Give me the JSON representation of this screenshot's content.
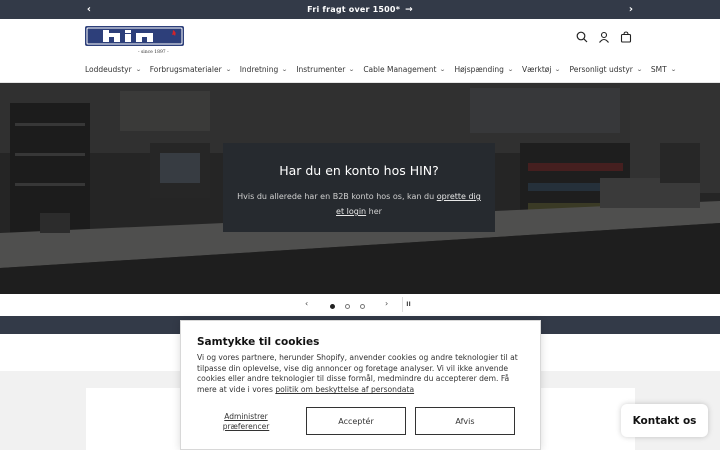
{
  "announcement": {
    "text": "Fri fragt over 1500*",
    "arrow": "→",
    "prev_icon": "chevron-left-icon",
    "next_icon": "chevron-right-icon"
  },
  "header": {
    "logo_text": "hin",
    "logo_tagline": "- since 1897 -",
    "icons": [
      "search-icon",
      "account-icon",
      "cart-icon"
    ]
  },
  "nav": {
    "items": [
      {
        "label": "Loddeudstyr"
      },
      {
        "label": "Forbrugsmaterialer"
      },
      {
        "label": "Indretning"
      },
      {
        "label": "Instrumenter"
      },
      {
        "label": "Cable Management"
      },
      {
        "label": "Højspænding"
      },
      {
        "label": "Værktøj"
      },
      {
        "label": "Personligt udstyr"
      },
      {
        "label": "SMT"
      }
    ]
  },
  "hero": {
    "title": "Har du en konto hos HIN?",
    "text_before": "Hvis du allerede har en B2B konto hos os, kan du ",
    "link1": "oprette dig et login",
    "text_after": " her"
  },
  "slider": {
    "prev": "‹",
    "next": "›",
    "pause": "II",
    "slides": 3,
    "active_slide": 1
  },
  "cookie": {
    "title": "Samtykke til cookies",
    "body": "Vi og vores partnere, herunder Shopify, anvender cookies og andre teknologier til at tilpasse din oplevelse, vise dig annoncer og foretage analyser. Vi vil ikke anvende cookies eller andre teknologier til disse formål, medmindre du accepterer dem. Få mere at vide i vores ",
    "policy_link": "politik om beskyttelse af persondata",
    "preferences": "Administrer præferencer",
    "accept": "Acceptér",
    "reject": "Afvis"
  },
  "chat": {
    "label": "Kontakt os"
  },
  "colors": {
    "dark_bar": "#333a48",
    "logo_blue": "#2d3f7a",
    "logo_red": "#d2232a"
  }
}
